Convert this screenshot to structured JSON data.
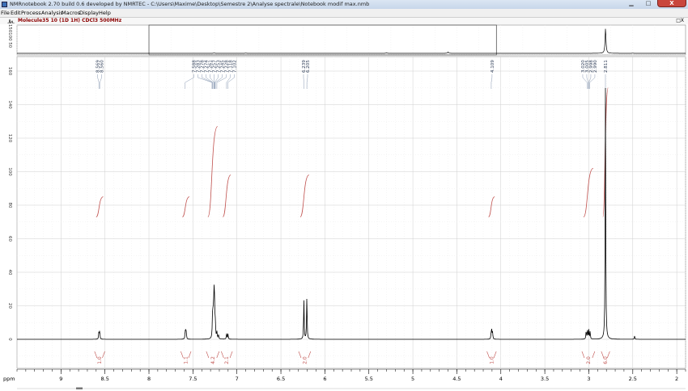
{
  "app": {
    "title": "NMRnotebook 2.70  build 0.6 developed by NMRTEC - C:\\Users\\Maxime\\Desktop\\Semestre 2\\Analyse spectrale\\Notebook modif max.nmb",
    "window_controls": {
      "close_glyph": "X"
    }
  },
  "menu": {
    "items": [
      "File",
      "Edit",
      "Process",
      "Analysis",
      "Macros",
      "Display",
      "Help"
    ]
  },
  "document": {
    "title": "Molecule35 10 (1D 1H) CDCl3 500MHz",
    "controls": "□X"
  },
  "colors": {
    "spectrum": "#000000",
    "integral": "#c0504d",
    "grid": "#d8d8d8",
    "labels": "#2b3a55"
  },
  "chart_data": {
    "type": "line",
    "xlabel": "ppm",
    "ylabel": "",
    "xlim": [
      9.5,
      1.9
    ],
    "xaxis_reversed": true,
    "ylim": [
      -10,
      170
    ],
    "x_ticks": [
      9,
      8.5,
      8,
      7.5,
      7,
      6.5,
      6,
      5.5,
      5,
      4.5,
      4,
      3.5,
      3,
      2.5,
      2
    ],
    "x_tick_labels": [
      "9",
      "8.5",
      "8",
      "7.5",
      "7",
      "6.5",
      "6",
      "5.5",
      "5",
      "4.5",
      "4",
      "3.5",
      "3",
      "2.5",
      "2"
    ],
    "y_ticks": [
      0,
      20,
      40,
      60,
      80,
      100,
      120,
      140,
      160
    ],
    "y_tick_labels": [
      "0",
      "20",
      "40",
      "60",
      "80",
      "100",
      "120",
      "140",
      "160"
    ],
    "grid": true,
    "overview": {
      "y_tick_labels": [
        "50",
        "100",
        "150"
      ],
      "window_ppm": [
        8.0,
        4.05
      ],
      "peaks": [
        {
          "ppm": 7.26,
          "height": 2
        },
        {
          "ppm": 6.9,
          "height": 1.5
        },
        {
          "ppm": 5.3,
          "height": 3
        },
        {
          "ppm": 4.6,
          "height": 8
        },
        {
          "ppm": 2.81,
          "height": 150
        },
        {
          "ppm": 2.5,
          "height": 1
        }
      ]
    },
    "peaks": [
      {
        "ppm": 8.569,
        "height": 4.5
      },
      {
        "ppm": 8.56,
        "height": 5
      },
      {
        "ppm": 7.588,
        "height": 3.5
      },
      {
        "ppm": 7.583,
        "height": 4.5
      },
      {
        "ppm": 7.576,
        "height": 4
      },
      {
        "ppm": 7.278,
        "height": 9
      },
      {
        "ppm": 7.274,
        "height": 10
      },
      {
        "ppm": 7.267,
        "height": 14
      },
      {
        "ppm": 7.261,
        "height": 19
      },
      {
        "ppm": 7.257,
        "height": 15
      },
      {
        "ppm": 7.253,
        "height": 12
      },
      {
        "ppm": 7.245,
        "height": 8
      },
      {
        "ppm": 7.228,
        "height": 4
      },
      {
        "ppm": 7.21,
        "height": 2.5
      },
      {
        "ppm": 7.118,
        "height": 3.5
      },
      {
        "ppm": 7.102,
        "height": 3.5
      },
      {
        "ppm": 6.239,
        "height": 24
      },
      {
        "ppm": 6.205,
        "height": 26
      },
      {
        "ppm": 4.103,
        "height": 5
      },
      {
        "ppm": 4.11,
        "height": 4
      },
      {
        "ppm": 4.094,
        "height": 4
      },
      {
        "ppm": 3.03,
        "height": 5
      },
      {
        "ppm": 3.015,
        "height": 6
      },
      {
        "ppm": 3.0,
        "height": 5.5
      },
      {
        "ppm": 2.985,
        "height": 4.5
      },
      {
        "ppm": 2.811,
        "height": 150
      },
      {
        "ppm": 2.48,
        "height": 2
      }
    ],
    "peak_labels": [
      {
        "labels": [
          "8.569",
          "8.560"
        ],
        "at_ppm": 8.56
      },
      {
        "labels": [
          "7.588",
          "7.283",
          "7.278",
          "7.274",
          "7.261",
          "7.257",
          "7.253",
          "7.245",
          "7.228",
          "7.118",
          "7.102"
        ],
        "at_ppm": 7.26
      },
      {
        "labels": [
          "6.239",
          "6.205"
        ],
        "at_ppm": 6.22
      },
      {
        "labels": [
          "4.109"
        ],
        "at_ppm": 4.1
      },
      {
        "labels": [
          "3.020",
          "3.005",
          "2.998",
          "2.990"
        ],
        "at_ppm": 3.0
      },
      {
        "labels": [
          "2.811"
        ],
        "at_ppm": 2.811
      }
    ],
    "integrals": [
      {
        "from": 8.6,
        "to": 8.52,
        "label": "1.0",
        "y_start": 73,
        "y_end": 85
      },
      {
        "from": 7.62,
        "to": 7.54,
        "label": "1.1",
        "y_start": 73,
        "y_end": 85
      },
      {
        "from": 7.33,
        "to": 7.22,
        "label": "4.2",
        "y_start": 73,
        "y_end": 127
      },
      {
        "from": 7.16,
        "to": 7.07,
        "label": "2.1",
        "y_start": 73,
        "y_end": 98
      },
      {
        "from": 6.28,
        "to": 6.18,
        "label": "2.0",
        "y_start": 73,
        "y_end": 98
      },
      {
        "from": 4.14,
        "to": 4.07,
        "label": "1.0",
        "y_start": 73,
        "y_end": 85
      },
      {
        "from": 3.06,
        "to": 2.95,
        "label": "2.0",
        "y_start": 73,
        "y_end": 102
      },
      {
        "from": 2.84,
        "to": 2.78,
        "label": "6.0",
        "y_start": 73,
        "y_end": 150
      }
    ]
  }
}
